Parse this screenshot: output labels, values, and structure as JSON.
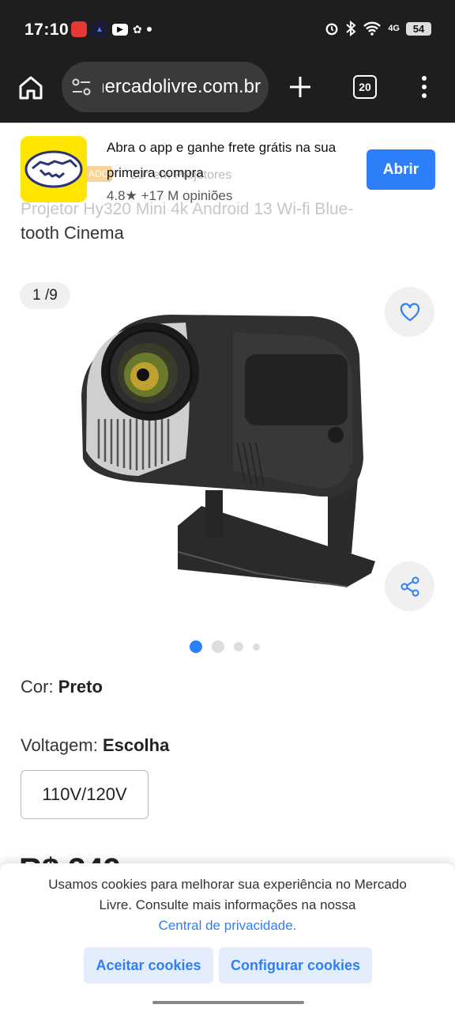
{
  "status_bar": {
    "time": "17:10",
    "network": "4G",
    "battery": "54"
  },
  "browser": {
    "url": "mercadolivre.com.br",
    "tab_count": "20"
  },
  "app_banner": {
    "message": "Abra o app e ganhe frete grátis na sua primeira compra",
    "open_label": "Abrir",
    "ghost_rating": "4.8★  +17 M opiniões",
    "ghost_category": "20° em Projetores"
  },
  "product": {
    "title_line1": "Projetor Hy320 Mini 4k Android 13 Wi-fi Blue-",
    "title_line2": "tooth Cinema",
    "image_counter": "1 /9",
    "price_partial": "R$ 349"
  },
  "options": {
    "color_label": "Cor: ",
    "color_value": "Preto",
    "voltage_label": "Voltagem: ",
    "voltage_value": "Escolha",
    "voltage_option": "110V/120V"
  },
  "cookies": {
    "text": "Usamos cookies para melhorar sua experiência no Mercado Livre. Consulte mais informações na nossa",
    "link": "Central de privacidade.",
    "accept_label": "Aceitar cookies",
    "configure_label": "Configurar cookies"
  },
  "colors": {
    "accent": "#2d7ff9",
    "brand_yellow": "#ffe600",
    "dark_bar": "#1e1e1e"
  },
  "icons": [
    "home-icon",
    "tune-icon",
    "plus-icon",
    "tabs-icon",
    "menu-icon",
    "heart-icon",
    "share-icon",
    "handshake-logo-icon"
  ]
}
